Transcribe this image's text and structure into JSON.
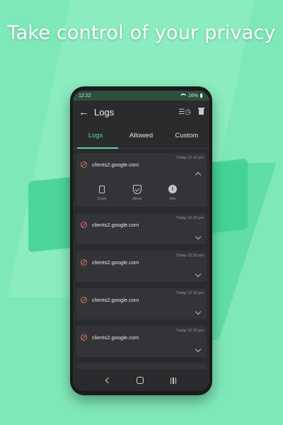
{
  "headline": "Take control of your privacy",
  "status_bar": {
    "time": "12:22",
    "battery": "16%"
  },
  "toolbar": {
    "title": "Logs"
  },
  "tabs": [
    {
      "label": "Logs",
      "active": true
    },
    {
      "label": "Allowed",
      "active": false
    },
    {
      "label": "Custom",
      "active": false
    }
  ],
  "logs": [
    {
      "domain": "clients2.google.com",
      "time": "Today 12:22 pm",
      "expanded": true
    },
    {
      "domain": "clients2.google.com",
      "time": "Today 12:22 pm",
      "expanded": false
    },
    {
      "domain": "clients2.google.com",
      "time": "Today 12:22 pm",
      "expanded": false
    },
    {
      "domain": "clients2.google.com",
      "time": "Today 12:22 pm",
      "expanded": false
    },
    {
      "domain": "clients2.google.com",
      "time": "Today 12:22 pm",
      "expanded": false
    }
  ],
  "actions": {
    "copy": "Copy",
    "allow": "Allow",
    "info": "Info"
  },
  "colors": {
    "accent": "#5fd39e",
    "blocked": "#d86a6a",
    "background": "#7fe8b9"
  },
  "icons": {
    "back": "arrow-left-icon",
    "filter": "filter-clock-icon",
    "delete": "trash-icon",
    "blocked": "block-icon",
    "copy": "copy-icon",
    "allow": "shield-check-icon",
    "info": "info-icon"
  }
}
